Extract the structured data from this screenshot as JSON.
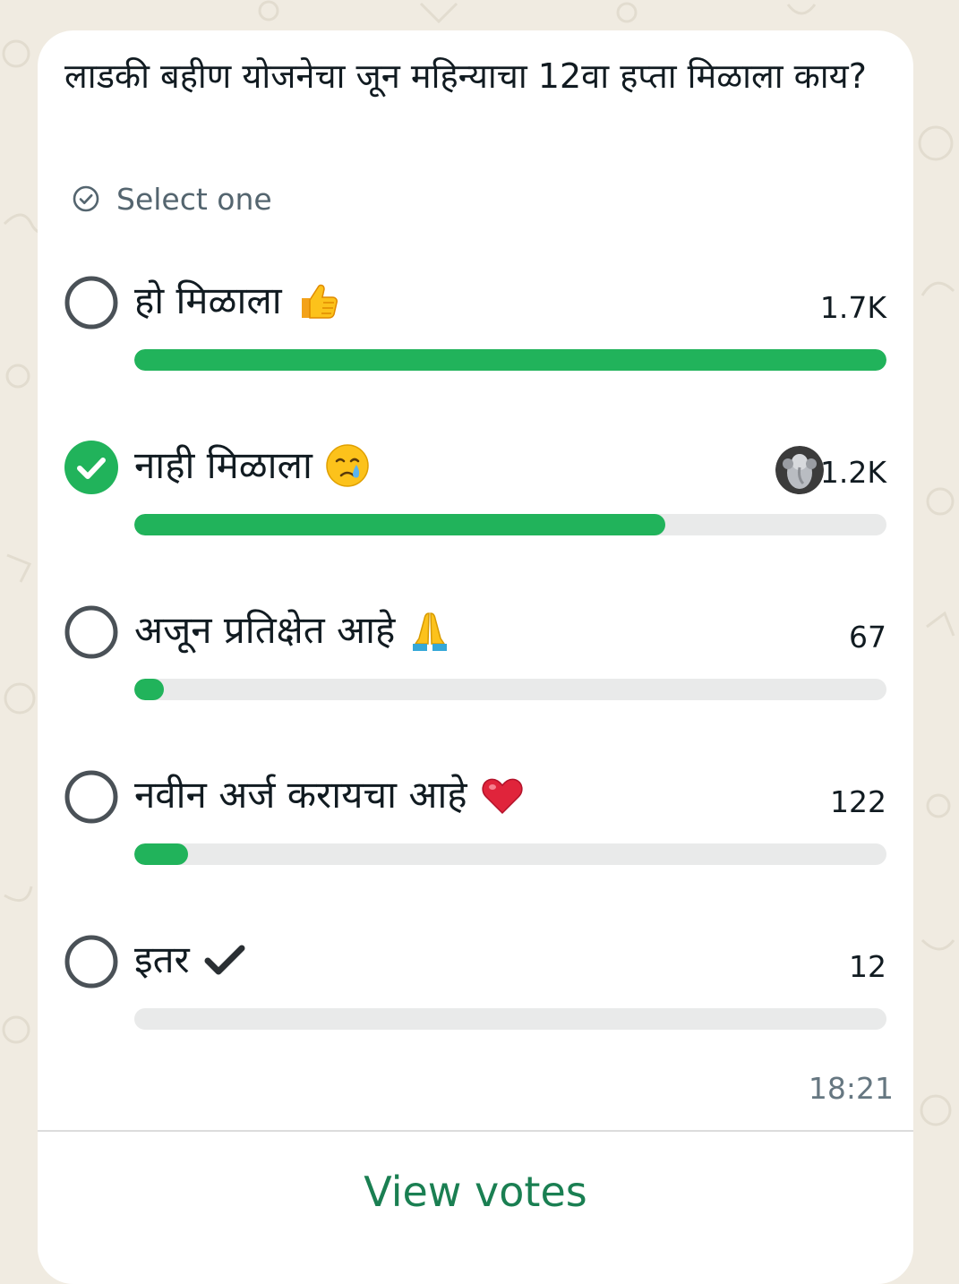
{
  "poll": {
    "question": "लाडकी बहीण योजनेचा जून महिन्याचा 12वा हप्ता मिळाला काय?",
    "select_hint": "Select one",
    "timestamp": "18:21",
    "view_votes_label": "View votes",
    "accent_color": "#21b35b",
    "options": [
      {
        "label": "हो मिळाला",
        "emoji": "thumbs-up-icon",
        "count": "1.7K",
        "votes": 1700,
        "selected": false
      },
      {
        "label": "नाही मिळाला",
        "emoji": "crying-face-icon",
        "count": "1.2K",
        "votes": 1200,
        "selected": true,
        "voter_avatar": "ganesha-avatar"
      },
      {
        "label": "अजून प्रतिक्षेत आहे",
        "emoji": "folded-hands-icon",
        "count": "67",
        "votes": 67,
        "selected": false
      },
      {
        "label": "नवीन अर्ज करायचा आहे",
        "emoji": "red-heart-icon",
        "count": "122",
        "votes": 122,
        "selected": false
      },
      {
        "label": "इतर",
        "emoji": "check-mark-icon",
        "count": "12",
        "votes": 12,
        "selected": false
      }
    ]
  }
}
